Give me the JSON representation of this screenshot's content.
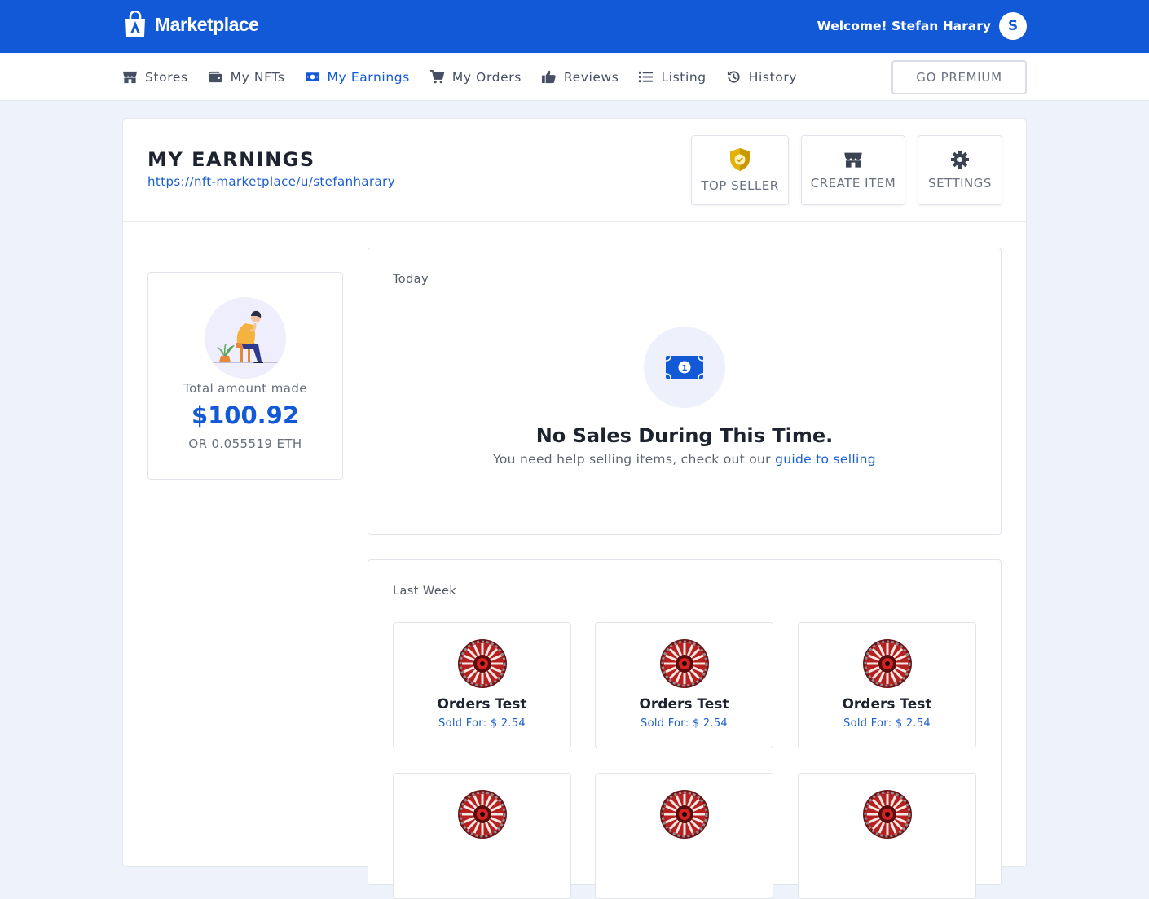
{
  "header": {
    "brand": "Marketplace",
    "welcome": "Welcome! Stefan Harary",
    "avatar_initial": "S",
    "brand_color": "#1259d8"
  },
  "nav": {
    "items": [
      {
        "label": "Stores",
        "icon": "store-icon"
      },
      {
        "label": "My NFTs",
        "icon": "wallet-icon"
      },
      {
        "label": "My Earnings",
        "icon": "money-bill-icon",
        "active": true
      },
      {
        "label": "My Orders",
        "icon": "cart-icon"
      },
      {
        "label": "Reviews",
        "icon": "thumbs-up-icon"
      },
      {
        "label": "Listing",
        "icon": "list-icon"
      },
      {
        "label": "History",
        "icon": "history-icon"
      }
    ],
    "premium_label": "GO PREMIUM"
  },
  "page": {
    "title": "MY EARNINGS",
    "profile_url": "https://nft-marketplace/u/stefanharary",
    "actions": [
      {
        "label": "TOP SELLER",
        "icon": "shield-check-icon"
      },
      {
        "label": "CREATE ITEM",
        "icon": "store-icon"
      },
      {
        "label": "SETTINGS",
        "icon": "gear-icon"
      }
    ]
  },
  "total": {
    "label": "Total amount made",
    "value": "$100.92",
    "eth": "OR 0.055519 ETH"
  },
  "today": {
    "title": "Today",
    "empty_title": "No Sales During This Time.",
    "empty_text": "You need help selling items, check out our",
    "empty_link": "guide to selling"
  },
  "last_week": {
    "title": "Last Week",
    "sales": [
      {
        "name": "Orders Test",
        "price": "Sold For: $ 2.54"
      },
      {
        "name": "Orders Test",
        "price": "Sold For: $ 2.54"
      },
      {
        "name": "Orders Test",
        "price": "Sold For: $ 2.54"
      },
      {
        "name": "",
        "price": ""
      },
      {
        "name": "",
        "price": ""
      },
      {
        "name": "",
        "price": ""
      }
    ]
  }
}
